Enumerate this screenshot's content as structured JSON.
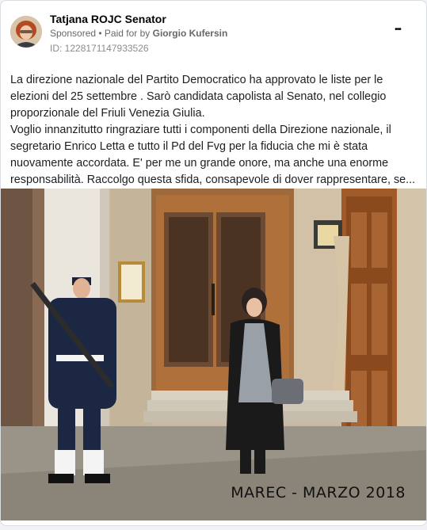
{
  "advertiser": {
    "name": "Tatjana ROJC Senator",
    "sponsored_label": "Sponsored",
    "separator": " • ",
    "paid_for_label": "Paid for by ",
    "payer": "Giorgio Kufersin",
    "library_id": "ID: 1228171147933526"
  },
  "menu": {
    "more_icon": "more-horizontal-icon",
    "more_glyph": "•••"
  },
  "post": {
    "paragraph_1": "La direzione nazionale del Partito Democratico ha approvato le liste per le elezioni del 25 settembre . Sarò candidata capolista al Senato, nel collegio proporzionale del Friuli Venezia Giulia.",
    "paragraph_2": "Voglio innanzitutto ringraziare tutti i componenti della Direzione nazionale, il segretario Enrico Letta e tutto il Pd del Fvg per la fiducia che mi è stata nuovamente accordata. E' per me un grande onore, ma anche una enorme responsabilità. Raccolgo questa sfida, consapevole di dover rappresentare, se..."
  },
  "media": {
    "watermark": "MAREC - MARZO 2018"
  },
  "colors": {
    "card_border": "#dadde1",
    "secondary_text": "#65676b",
    "door_wood": "#b0703a",
    "coat_navy": "#1c2743"
  }
}
